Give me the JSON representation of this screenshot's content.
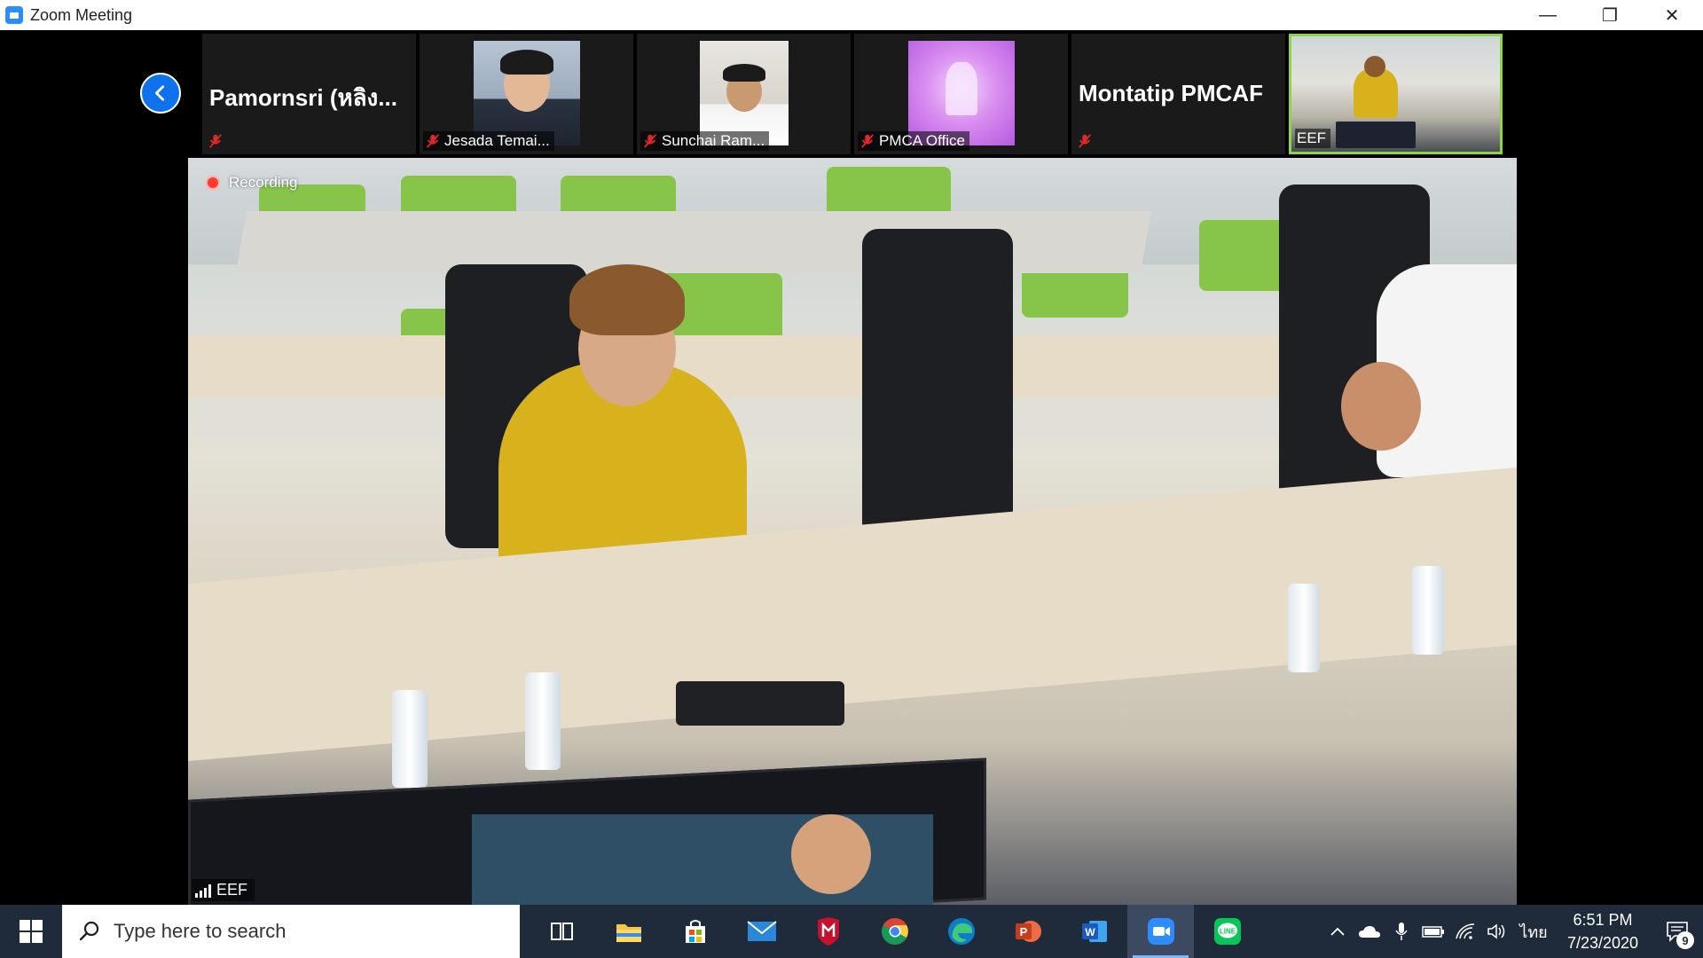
{
  "window": {
    "title": "Zoom Meeting",
    "controls": {
      "minimize": "—",
      "restore": "❐",
      "close": "✕"
    }
  },
  "participants": [
    {
      "name": "Pamornsri  (หลิง...",
      "display": "name-only",
      "muted": true
    },
    {
      "name": "Jesada Temai...",
      "display": "video",
      "muted": true
    },
    {
      "name": "Sunchai Ram...",
      "display": "video",
      "muted": true
    },
    {
      "name": "PMCA Office",
      "display": "video",
      "muted": true
    },
    {
      "name": "Montatip PMCAF",
      "display": "name-only",
      "muted": true
    },
    {
      "name": "EEF",
      "display": "video",
      "muted": false,
      "active_speaker": true
    }
  ],
  "main_video": {
    "recording_label": "Recording",
    "speaker_label": "EEF"
  },
  "taskbar": {
    "search_placeholder": "Type here to search",
    "apps": [
      "task-view-icon",
      "file-explorer-icon",
      "microsoft-store-icon",
      "mail-icon",
      "mcafee-icon",
      "chrome-icon",
      "edge-icon",
      "powerpoint-icon",
      "word-icon",
      "zoom-icon",
      "line-icon"
    ],
    "active_app": "zoom-icon",
    "input_language": "ไทย",
    "time": "6:51 PM",
    "date": "7/23/2020",
    "notification_count": "9"
  },
  "colors": {
    "zoom_blue": "#0e72ed",
    "active_speaker_border": "#8ed34a",
    "recording_red": "#ff3b30",
    "taskbar_bg": "#1f2a3a"
  }
}
